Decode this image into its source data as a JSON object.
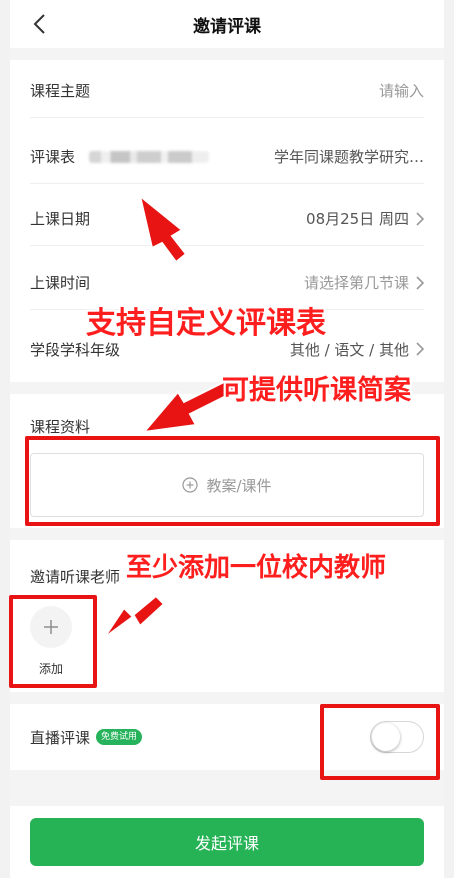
{
  "header": {
    "title": "邀请评课"
  },
  "form": {
    "topic": {
      "label": "课程主题",
      "placeholder": "请输入"
    },
    "eval_form": {
      "label": "评课表",
      "value": "学年同课题教学研究…"
    },
    "date": {
      "label": "上课日期",
      "value": "08月25日 周四"
    },
    "time": {
      "label": "上课时间",
      "placeholder": "请选择第几节课"
    },
    "grade_subject": {
      "label": "学段学科年级",
      "value": "其他 / 语文 / 其他"
    }
  },
  "materials": {
    "title": "课程资料",
    "upload_label": "教案/课件"
  },
  "teachers": {
    "title": "邀请听课老师",
    "add_label": "添加"
  },
  "live": {
    "label": "直播评课",
    "badge": "免费试用",
    "enabled": false
  },
  "submit": {
    "label": "发起评课"
  },
  "annotations": {
    "custom_form": "支持自定义评课表",
    "lesson_plan": "可提供听课简案",
    "teacher_hint": "至少添加一位校内教师"
  },
  "colors": {
    "primary": "#26b356",
    "annotation": "#e81414"
  }
}
